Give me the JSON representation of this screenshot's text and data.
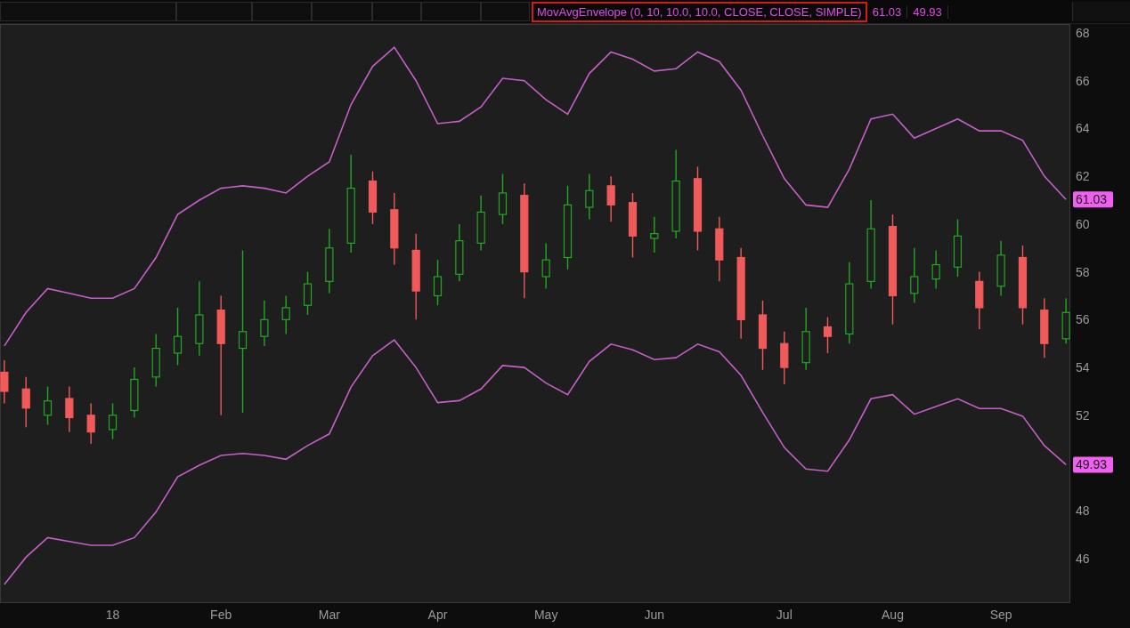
{
  "header": {
    "study_label": "MovAvgEnvelope (0, 10, 10.0, 10.0, CLOSE, CLOSE, SIMPLE)",
    "readings": [
      "61.03",
      "49.93"
    ]
  },
  "chart_data": {
    "type": "candlestick",
    "categories": [
      null,
      null,
      null,
      null,
      null,
      "18",
      null,
      null,
      null,
      null,
      "Feb",
      null,
      null,
      null,
      null,
      "Mar",
      null,
      null,
      null,
      null,
      "Apr",
      null,
      null,
      null,
      null,
      "May",
      null,
      null,
      null,
      null,
      "Jun",
      null,
      null,
      null,
      null,
      null,
      "Jul",
      null,
      null,
      null,
      null,
      "Aug",
      null,
      null,
      null,
      null,
      "Sep",
      null,
      null,
      null
    ],
    "ylim": [
      44.14,
      68.37
    ],
    "yticks": [
      46,
      48,
      52,
      54,
      56,
      58,
      60,
      62,
      64,
      66,
      68
    ],
    "ohlc": [
      [
        53.8,
        54.3,
        52.5,
        53.0
      ],
      [
        53.1,
        53.6,
        51.5,
        52.3
      ],
      [
        52.0,
        53.2,
        51.6,
        52.6
      ],
      [
        52.7,
        53.2,
        51.3,
        51.9
      ],
      [
        52.0,
        52.5,
        50.8,
        51.3
      ],
      [
        51.4,
        52.5,
        51.0,
        52.0
      ],
      [
        52.2,
        54.0,
        51.9,
        53.5
      ],
      [
        53.6,
        55.4,
        53.2,
        54.8
      ],
      [
        54.6,
        56.5,
        54.1,
        55.3
      ],
      [
        55.0,
        57.6,
        54.5,
        56.2
      ],
      [
        56.4,
        57.0,
        52.0,
        55.0
      ],
      [
        54.8,
        58.9,
        52.1,
        55.5
      ],
      [
        55.3,
        56.8,
        54.9,
        56.0
      ],
      [
        56.0,
        57.0,
        55.4,
        56.5
      ],
      [
        56.6,
        58.0,
        56.2,
        57.5
      ],
      [
        57.6,
        59.8,
        57.1,
        59.0
      ],
      [
        59.2,
        62.9,
        58.8,
        61.5
      ],
      [
        61.8,
        62.2,
        60.0,
        60.5
      ],
      [
        60.6,
        61.3,
        58.3,
        59.0
      ],
      [
        58.9,
        59.6,
        56.0,
        57.2
      ],
      [
        57.0,
        58.5,
        56.6,
        57.8
      ],
      [
        57.9,
        60.0,
        57.6,
        59.3
      ],
      [
        59.2,
        61.2,
        58.9,
        60.5
      ],
      [
        60.4,
        62.1,
        60.0,
        61.3
      ],
      [
        61.2,
        61.7,
        56.9,
        58.0
      ],
      [
        57.8,
        59.2,
        57.3,
        58.5
      ],
      [
        58.6,
        61.6,
        58.1,
        60.8
      ],
      [
        60.7,
        62.1,
        60.2,
        61.4
      ],
      [
        61.6,
        62.0,
        60.1,
        60.8
      ],
      [
        60.9,
        61.3,
        58.6,
        59.5
      ],
      [
        59.4,
        60.3,
        58.8,
        59.6
      ],
      [
        59.7,
        63.1,
        59.4,
        61.8
      ],
      [
        61.9,
        62.4,
        58.9,
        59.7
      ],
      [
        59.8,
        60.3,
        57.6,
        58.5
      ],
      [
        58.6,
        59.0,
        55.2,
        56.0
      ],
      [
        56.2,
        56.8,
        53.9,
        54.8
      ],
      [
        55.0,
        55.5,
        53.3,
        54.0
      ],
      [
        54.2,
        56.5,
        53.9,
        55.5
      ],
      [
        55.7,
        56.1,
        54.6,
        55.3
      ],
      [
        55.4,
        58.4,
        55.0,
        57.5
      ],
      [
        57.6,
        61.0,
        57.3,
        59.8
      ],
      [
        59.9,
        60.4,
        55.8,
        57.0
      ],
      [
        57.1,
        59.0,
        56.7,
        57.8
      ],
      [
        57.7,
        58.9,
        57.3,
        58.3
      ],
      [
        58.2,
        60.2,
        57.8,
        59.5
      ],
      [
        57.6,
        58.0,
        55.6,
        56.5
      ],
      [
        57.4,
        59.3,
        57.0,
        58.7
      ],
      [
        58.6,
        59.1,
        55.8,
        56.5
      ],
      [
        56.4,
        56.9,
        54.4,
        55.0
      ],
      [
        55.2,
        56.9,
        55.0,
        56.3
      ]
    ],
    "series": [
      {
        "type": "line",
        "color": "#c560c8",
        "values": [
          54.9,
          56.3,
          57.3,
          57.1,
          56.9,
          56.9,
          57.3,
          58.6,
          60.4,
          61.0,
          61.5,
          61.6,
          61.5,
          61.3,
          62.0,
          62.6,
          65.0,
          66.6,
          67.4,
          66.0,
          64.2,
          64.3,
          64.9,
          66.1,
          66.0,
          65.2,
          64.6,
          66.3,
          67.2,
          66.9,
          66.4,
          66.5,
          67.2,
          66.8,
          65.6,
          63.7,
          61.9,
          60.8,
          60.7,
          62.3,
          64.4,
          64.6,
          63.6,
          64.0,
          64.4,
          63.9,
          63.9,
          63.5,
          62.0,
          61.03
        ]
      },
      {
        "type": "line",
        "color": "#c560c8",
        "values": [
          44.92,
          46.06,
          46.88,
          46.72,
          46.56,
          46.56,
          46.88,
          47.95,
          49.42,
          49.91,
          50.32,
          50.4,
          50.32,
          50.16,
          50.73,
          51.22,
          53.18,
          54.49,
          55.15,
          54.0,
          52.53,
          52.61,
          53.1,
          54.08,
          54.0,
          53.35,
          52.86,
          54.25,
          54.98,
          54.74,
          54.33,
          54.41,
          54.98,
          54.66,
          53.67,
          52.12,
          50.65,
          49.75,
          49.66,
          50.97,
          52.69,
          52.86,
          52.04,
          52.36,
          52.69,
          52.28,
          52.28,
          51.96,
          50.73,
          49.93
        ]
      }
    ]
  },
  "price_badges": [
    {
      "label": "61.03"
    },
    {
      "label": "49.93"
    }
  ]
}
